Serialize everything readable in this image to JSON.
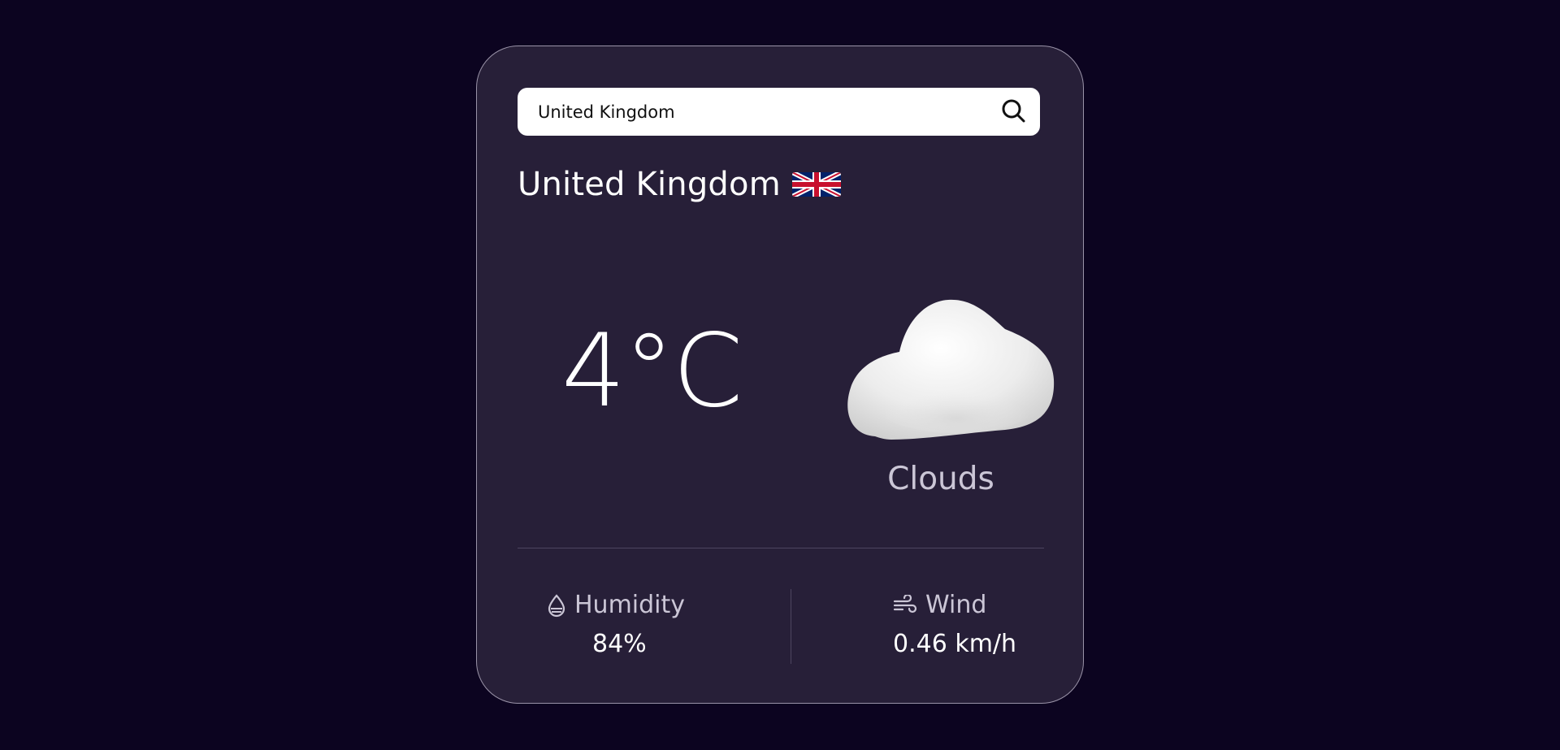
{
  "search": {
    "value": "United Kingdom",
    "icon": "search-icon"
  },
  "location": {
    "city": "United Kingdom",
    "flag_icon": "uk-flag-icon"
  },
  "weather": {
    "temperature": "4°C",
    "condition": "Clouds",
    "condition_icon": "cloud-icon"
  },
  "stats": {
    "humidity_label": "Humidity",
    "humidity_value": "84%",
    "humidity_icon": "droplet-icon",
    "wind_label": "Wind",
    "wind_value": "0.46 km/h",
    "wind_icon": "wind-icon"
  },
  "colors": {
    "page_background": "#0c0420",
    "card_background": "#271f38",
    "primary_text": "#ffffff",
    "secondary_text": "#cbc6d6"
  }
}
